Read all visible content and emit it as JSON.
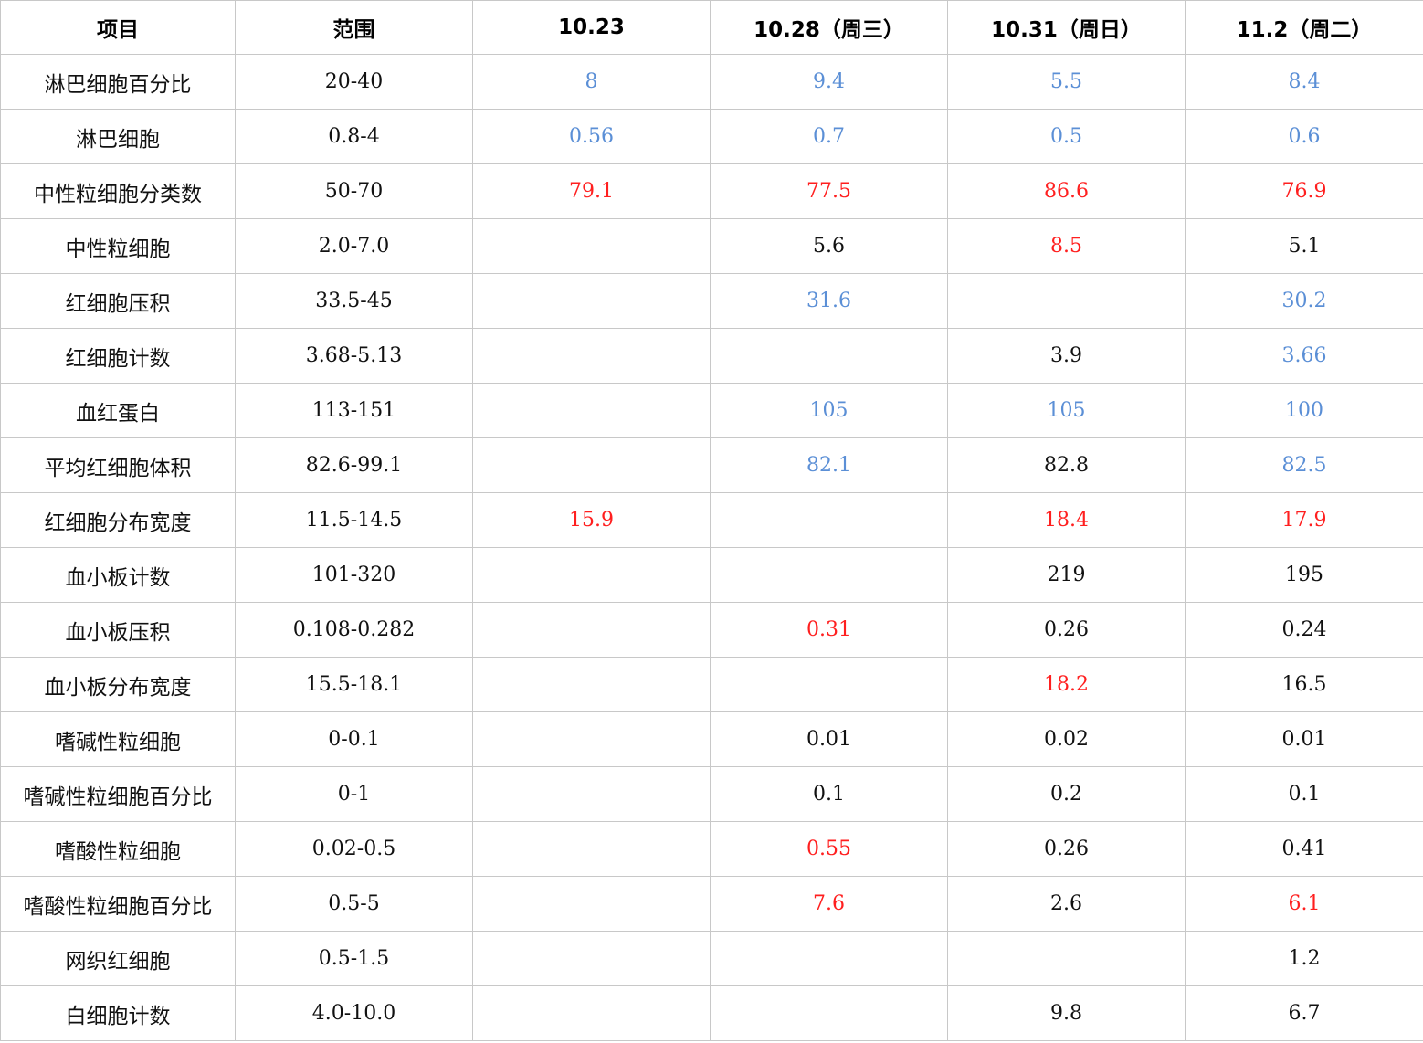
{
  "colors": {
    "low": "#5b8fd6",
    "high": "#ff1f1f",
    "normal": "#111111",
    "grid_line": "#c8c8c8"
  },
  "table": {
    "headers": [
      "项目",
      "范围",
      "10.23",
      "10.28（周三）",
      "10.31（周日）",
      "11.2（周二）"
    ],
    "rows": [
      {
        "name": "淋巴细胞百分比",
        "range": "20-40",
        "values": [
          {
            "text": "8",
            "status": "low"
          },
          {
            "text": "9.4",
            "status": "low"
          },
          {
            "text": "5.5",
            "status": "low"
          },
          {
            "text": "8.4",
            "status": "low"
          }
        ]
      },
      {
        "name": "淋巴细胞",
        "range": "0.8-4",
        "values": [
          {
            "text": "0.56",
            "status": "low"
          },
          {
            "text": "0.7",
            "status": "low"
          },
          {
            "text": "0.5",
            "status": "low"
          },
          {
            "text": "0.6",
            "status": "low"
          }
        ]
      },
      {
        "name": "中性粒细胞分类数",
        "range": "50-70",
        "values": [
          {
            "text": "79.1",
            "status": "high"
          },
          {
            "text": "77.5",
            "status": "high"
          },
          {
            "text": "86.6",
            "status": "high"
          },
          {
            "text": "76.9",
            "status": "high"
          }
        ]
      },
      {
        "name": "中性粒细胞",
        "range": "2.0-7.0",
        "values": [
          {
            "text": "",
            "status": "normal"
          },
          {
            "text": "5.6",
            "status": "normal"
          },
          {
            "text": "8.5",
            "status": "high"
          },
          {
            "text": "5.1",
            "status": "normal"
          }
        ]
      },
      {
        "name": "红细胞压积",
        "range": "33.5-45",
        "values": [
          {
            "text": "",
            "status": "normal"
          },
          {
            "text": "31.6",
            "status": "low"
          },
          {
            "text": "",
            "status": "normal"
          },
          {
            "text": "30.2",
            "status": "low"
          }
        ]
      },
      {
        "name": "红细胞计数",
        "range": "3.68-5.13",
        "values": [
          {
            "text": "",
            "status": "normal"
          },
          {
            "text": "",
            "status": "normal"
          },
          {
            "text": "3.9",
            "status": "normal"
          },
          {
            "text": "3.66",
            "status": "low"
          }
        ]
      },
      {
        "name": "血红蛋白",
        "range": "113-151",
        "values": [
          {
            "text": "",
            "status": "normal"
          },
          {
            "text": "105",
            "status": "low"
          },
          {
            "text": "105",
            "status": "low"
          },
          {
            "text": "100",
            "status": "low"
          }
        ]
      },
      {
        "name": "平均红细胞体积",
        "range": "82.6-99.1",
        "values": [
          {
            "text": "",
            "status": "normal"
          },
          {
            "text": "82.1",
            "status": "low"
          },
          {
            "text": "82.8",
            "status": "normal"
          },
          {
            "text": "82.5",
            "status": "low"
          }
        ]
      },
      {
        "name": "红细胞分布宽度",
        "range": "11.5-14.5",
        "values": [
          {
            "text": "15.9",
            "status": "high"
          },
          {
            "text": "",
            "status": "normal"
          },
          {
            "text": "18.4",
            "status": "high"
          },
          {
            "text": "17.9",
            "status": "high"
          }
        ]
      },
      {
        "name": "血小板计数",
        "range": "101-320",
        "values": [
          {
            "text": "",
            "status": "normal"
          },
          {
            "text": "",
            "status": "normal"
          },
          {
            "text": "219",
            "status": "normal"
          },
          {
            "text": "195",
            "status": "normal"
          }
        ]
      },
      {
        "name": "血小板压积",
        "range": "0.108-0.282",
        "values": [
          {
            "text": "",
            "status": "normal"
          },
          {
            "text": "0.31",
            "status": "high"
          },
          {
            "text": "0.26",
            "status": "normal"
          },
          {
            "text": "0.24",
            "status": "normal"
          }
        ]
      },
      {
        "name": "血小板分布宽度",
        "range": "15.5-18.1",
        "values": [
          {
            "text": "",
            "status": "normal"
          },
          {
            "text": "",
            "status": "normal"
          },
          {
            "text": "18.2",
            "status": "high"
          },
          {
            "text": "16.5",
            "status": "normal"
          }
        ]
      },
      {
        "name": "嗜碱性粒细胞",
        "range": "0-0.1",
        "values": [
          {
            "text": "",
            "status": "normal"
          },
          {
            "text": "0.01",
            "status": "normal"
          },
          {
            "text": "0.02",
            "status": "normal"
          },
          {
            "text": "0.01",
            "status": "normal"
          }
        ]
      },
      {
        "name": "嗜碱性粒细胞百分比",
        "range": "0-1",
        "values": [
          {
            "text": "",
            "status": "normal"
          },
          {
            "text": "0.1",
            "status": "normal"
          },
          {
            "text": "0.2",
            "status": "normal"
          },
          {
            "text": "0.1",
            "status": "normal"
          }
        ]
      },
      {
        "name": "嗜酸性粒细胞",
        "range": "0.02-0.5",
        "values": [
          {
            "text": "",
            "status": "normal"
          },
          {
            "text": "0.55",
            "status": "high"
          },
          {
            "text": "0.26",
            "status": "normal"
          },
          {
            "text": "0.41",
            "status": "normal"
          }
        ]
      },
      {
        "name": "嗜酸性粒细胞百分比",
        "range": "0.5-5",
        "values": [
          {
            "text": "",
            "status": "normal"
          },
          {
            "text": "7.6",
            "status": "high"
          },
          {
            "text": "2.6",
            "status": "normal"
          },
          {
            "text": "6.1",
            "status": "high"
          }
        ]
      },
      {
        "name": "网织红细胞",
        "range": "0.5-1.5",
        "values": [
          {
            "text": "",
            "status": "normal"
          },
          {
            "text": "",
            "status": "normal"
          },
          {
            "text": "",
            "status": "normal"
          },
          {
            "text": "1.2",
            "status": "normal"
          }
        ]
      },
      {
        "name": "白细胞计数",
        "range": "4.0-10.0",
        "values": [
          {
            "text": "",
            "status": "normal"
          },
          {
            "text": "",
            "status": "normal"
          },
          {
            "text": "9.8",
            "status": "normal"
          },
          {
            "text": "6.7",
            "status": "normal"
          }
        ]
      }
    ]
  }
}
